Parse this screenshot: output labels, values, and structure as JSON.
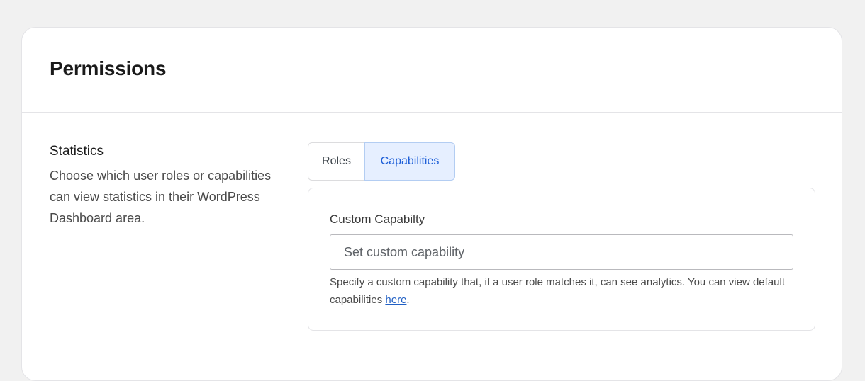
{
  "header": {
    "title": "Permissions"
  },
  "statistics": {
    "title": "Statistics",
    "description": "Choose which user roles or capabilities can view statistics in their WordPress Dashboard area."
  },
  "tabs": [
    {
      "label": "Roles",
      "active": false
    },
    {
      "label": "Capabilities",
      "active": true
    }
  ],
  "custom_capability": {
    "label": "Custom Capabilty",
    "value": "",
    "placeholder": "Set custom capability",
    "help_before": "Specify a custom capability that, if a user role matches it, can see analytics. You can view default capabilities ",
    "help_link": "here",
    "help_after": "."
  },
  "colors": {
    "active_tab_bg": "#e6efff",
    "active_tab_text": "#1e5fd8",
    "link": "#2160c4"
  }
}
